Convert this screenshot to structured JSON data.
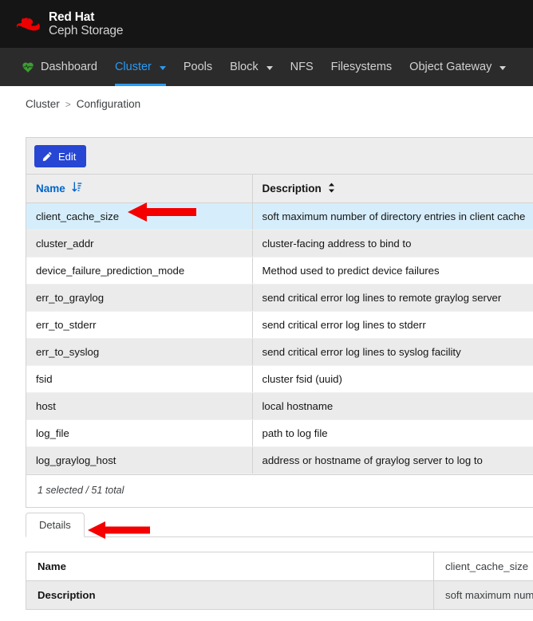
{
  "brand": {
    "line1": "Red Hat",
    "line2": "Ceph Storage",
    "logo_icon": "redhat-fedora-hat-icon"
  },
  "nav": {
    "items": [
      {
        "label": "Dashboard",
        "icon": "heart-pulse-icon",
        "has_caret": false,
        "active": false
      },
      {
        "label": "Cluster",
        "icon": "",
        "has_caret": true,
        "active": true
      },
      {
        "label": "Pools",
        "icon": "",
        "has_caret": false,
        "active": false
      },
      {
        "label": "Block",
        "icon": "",
        "has_caret": true,
        "active": false
      },
      {
        "label": "NFS",
        "icon": "",
        "has_caret": false,
        "active": false
      },
      {
        "label": "Filesystems",
        "icon": "",
        "has_caret": false,
        "active": false
      },
      {
        "label": "Object Gateway",
        "icon": "",
        "has_caret": true,
        "active": false
      }
    ],
    "active_color": "#2b9af3"
  },
  "breadcrumb": {
    "items": [
      "Cluster",
      "Configuration"
    ],
    "separator": ">"
  },
  "toolbar": {
    "edit_label": "Edit",
    "edit_icon": "pencil-icon",
    "edit_color": "#2746d4"
  },
  "table": {
    "columns": [
      {
        "label": "Name",
        "sort_icon": "sort-ascending-icon",
        "sorted": true
      },
      {
        "label": "Description",
        "sort_icon": "sort-both-icon",
        "sorted": false
      }
    ],
    "rows": [
      {
        "name": "client_cache_size",
        "description": "soft maximum number of directory entries in client cache",
        "selected": true
      },
      {
        "name": "cluster_addr",
        "description": "cluster-facing address to bind to",
        "selected": false
      },
      {
        "name": "device_failure_prediction_mode",
        "description": "Method used to predict device failures",
        "selected": false
      },
      {
        "name": "err_to_graylog",
        "description": "send critical error log lines to remote graylog server",
        "selected": false
      },
      {
        "name": "err_to_stderr",
        "description": "send critical error log lines to stderr",
        "selected": false
      },
      {
        "name": "err_to_syslog",
        "description": "send critical error log lines to syslog facility",
        "selected": false
      },
      {
        "name": "fsid",
        "description": "cluster fsid (uuid)",
        "selected": false
      },
      {
        "name": "host",
        "description": "local hostname",
        "selected": false
      },
      {
        "name": "log_file",
        "description": "path to log file",
        "selected": false
      },
      {
        "name": "log_graylog_host",
        "description": "address or hostname of graylog server to log to",
        "selected": false
      }
    ],
    "footer": "1 selected / 51 total",
    "selected_row_color": "#d6eefb"
  },
  "details": {
    "tabs": [
      {
        "label": "Details",
        "active": true
      }
    ],
    "rows": [
      {
        "key": "Name",
        "value": "client_cache_size"
      },
      {
        "key": "Description",
        "value": "soft maximum numb"
      }
    ]
  },
  "annotations": {
    "color": "#f50000",
    "arrows": [
      {
        "name": "arrow-pointing-to-client-cache-size-row"
      },
      {
        "name": "arrow-pointing-to-details-tab"
      }
    ]
  }
}
